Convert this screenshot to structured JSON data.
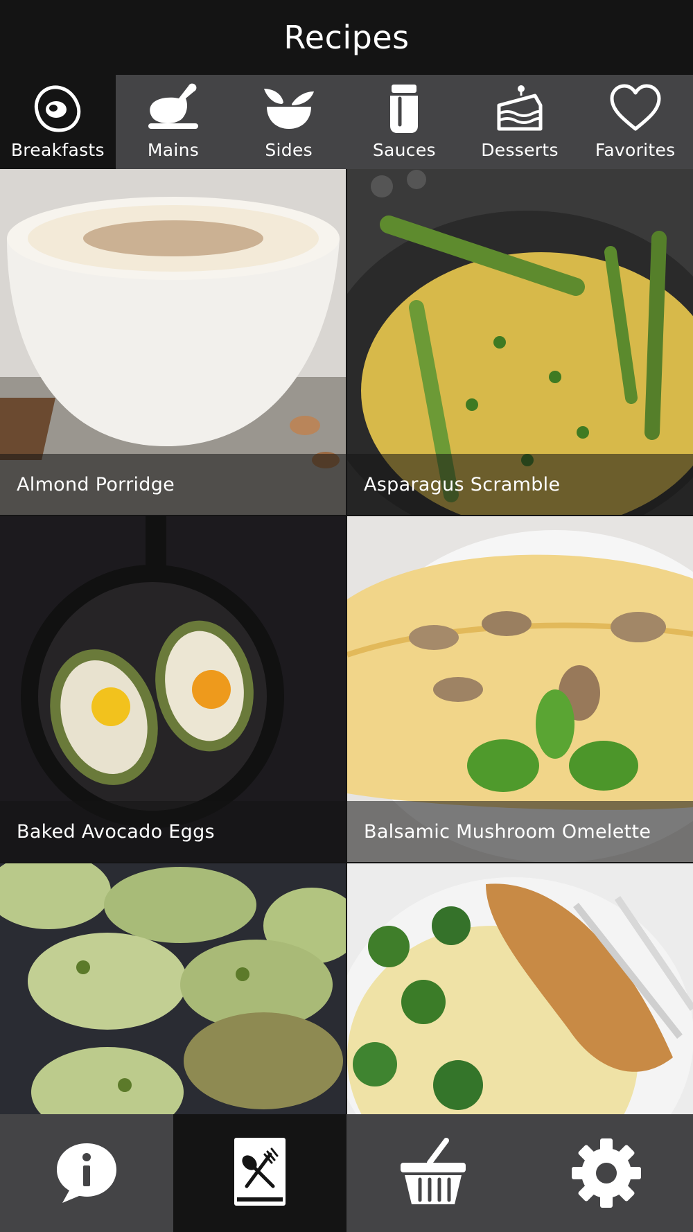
{
  "header": {
    "title": "Recipes"
  },
  "categories": [
    {
      "label": "Breakfasts",
      "icon": "egg-icon",
      "active": true
    },
    {
      "label": "Mains",
      "icon": "roast-chicken-icon",
      "active": false
    },
    {
      "label": "Sides",
      "icon": "salad-bowl-icon",
      "active": false
    },
    {
      "label": "Sauces",
      "icon": "sauce-jar-icon",
      "active": false
    },
    {
      "label": "Desserts",
      "icon": "cake-slice-icon",
      "active": false
    },
    {
      "label": "Favorites",
      "icon": "heart-icon",
      "active": false
    }
  ],
  "recipes": [
    {
      "title": "Almond Porridge"
    },
    {
      "title": "Asparagus Scramble"
    },
    {
      "title": "Baked Avocado Eggs"
    },
    {
      "title": "Balsamic Mushroom Omelette"
    },
    {
      "title": ""
    },
    {
      "title": ""
    }
  ],
  "tabs": [
    {
      "icon": "info-bubble-icon",
      "active": false
    },
    {
      "icon": "recipe-book-icon",
      "active": true
    },
    {
      "icon": "shopping-basket-icon",
      "active": false
    },
    {
      "icon": "gear-icon",
      "active": false
    }
  ],
  "colors": {
    "background": "#141414",
    "bar": "#444446",
    "active": "#141414"
  }
}
